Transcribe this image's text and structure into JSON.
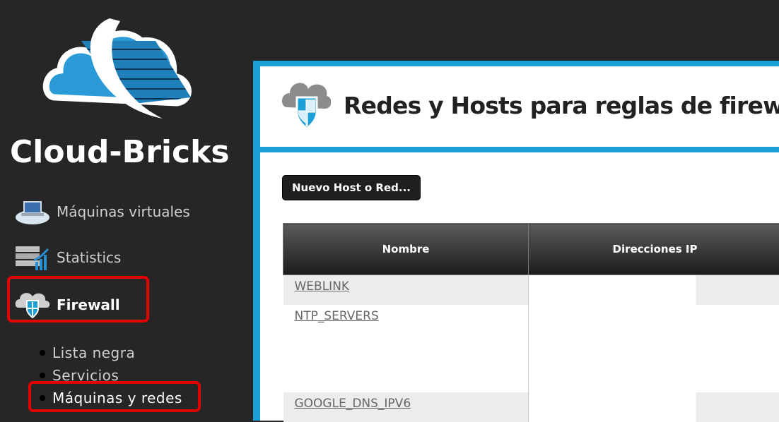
{
  "app": {
    "brand": "Cloud-Bricks"
  },
  "sidebar": {
    "items": [
      {
        "label": "Máquinas virtuales",
        "icon": "cloud-computer-icon"
      },
      {
        "label": "Statistics",
        "icon": "server-stats-icon"
      },
      {
        "label": "Firewall",
        "icon": "cloud-shield-icon",
        "active": true
      }
    ],
    "sub_items": [
      {
        "label": "Lista negra"
      },
      {
        "label": "Servicios"
      },
      {
        "label": "Máquinas y redes",
        "active": true
      }
    ]
  },
  "main": {
    "title": "Redes y Hosts para reglas de firewall",
    "new_button": "Nuevo Host o Red...",
    "table": {
      "headers": [
        "Nombre",
        "Direcciones IP"
      ],
      "rows": [
        {
          "name": "WEBLINK"
        },
        {
          "name": "NTP_SERVERS"
        },
        {
          "name": "GOOGLE_DNS_IPV6"
        }
      ]
    }
  },
  "colors": {
    "accent": "#1b9fd8",
    "highlight": "#e00000",
    "background": "#262626"
  }
}
